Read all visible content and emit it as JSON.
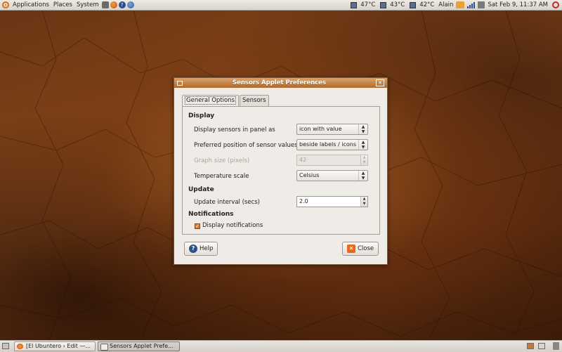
{
  "top_panel": {
    "menus": [
      "Applications",
      "Places",
      "System"
    ],
    "launchers": [
      "screenshot-icon",
      "firefox-icon",
      "help-icon",
      "thunderbird-icon"
    ],
    "sensors": [
      "47°C",
      "43°C",
      "42°C"
    ],
    "user": "Alain",
    "datetime": "Sat Feb  9, 11:37 AM"
  },
  "dialog": {
    "title": "Sensors Applet Preferences",
    "tabs": [
      "General Options",
      "Sensors"
    ],
    "display": {
      "heading": "Display",
      "display_sensors_label": "Display sensors in panel as",
      "display_sensors_value": "icon with value",
      "position_label": "Preferred position of sensor values",
      "position_value": "beside labels / icons",
      "graph_size_label": "Graph size (pixels)",
      "graph_size_value": "42",
      "temp_scale_label": "Temperature scale",
      "temp_scale_value": "Celsius"
    },
    "update": {
      "heading": "Update",
      "interval_label": "Update interval (secs)",
      "interval_value": "2.0"
    },
    "notifications": {
      "heading": "Notifications",
      "checkbox_label": "Display notifications",
      "checked": true
    },
    "help_label": "Help",
    "close_label": "Close"
  },
  "taskbar": {
    "tasks": [
      "[El Ubuntero › Edit —...",
      "Sensors Applet Prefe..."
    ]
  },
  "colors": {
    "titlebar": "#b06a2c",
    "accent": "#e07a2a",
    "desktop": "#6a3514"
  }
}
